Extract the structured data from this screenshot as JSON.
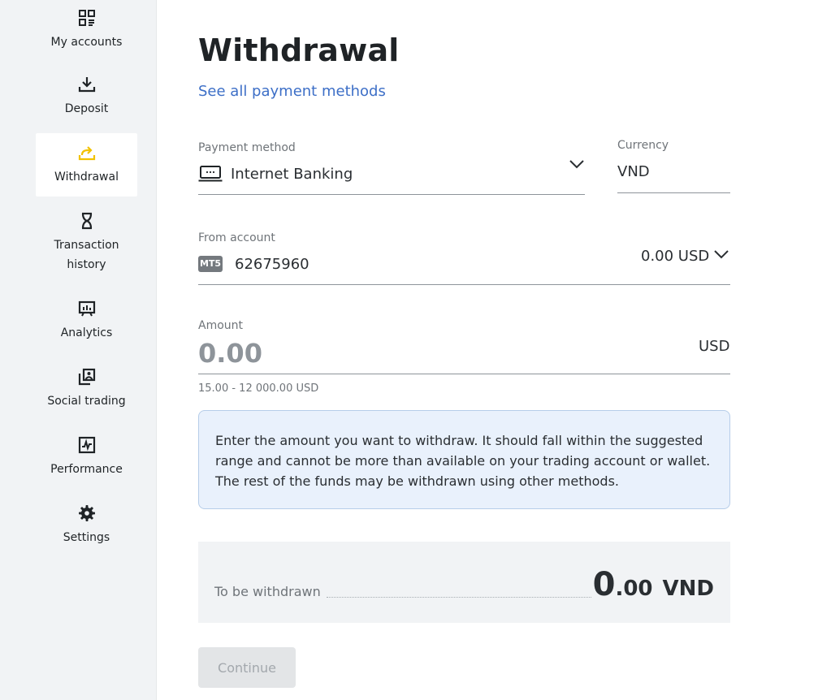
{
  "sidebar": {
    "items": [
      {
        "label": "My accounts",
        "icon": "accounts-grid-icon"
      },
      {
        "label": "Deposit",
        "icon": "download-icon"
      },
      {
        "label": "Withdrawal",
        "icon": "withdraw-upload-icon",
        "active": true
      },
      {
        "label": "Transaction\nhistory",
        "icon": "hourglass-icon"
      },
      {
        "label": "Analytics",
        "icon": "analytics-board-icon"
      },
      {
        "label": "Social trading",
        "icon": "social-trading-icon"
      },
      {
        "label": "Performance",
        "icon": "performance-chart-icon"
      },
      {
        "label": "Settings",
        "icon": "gear-icon"
      }
    ]
  },
  "page": {
    "title": "Withdrawal",
    "all_methods_link": "See all payment methods"
  },
  "payment_method": {
    "label": "Payment method",
    "value": "Internet Banking"
  },
  "currency": {
    "label": "Currency",
    "value": "VND"
  },
  "from_account": {
    "label": "From account",
    "platform_badge": "MT5",
    "account_number": "62675960",
    "balance": "0.00 USD"
  },
  "amount": {
    "label": "Amount",
    "placeholder": "0.00",
    "currency": "USD",
    "range_hint": "15.00 - 12 000.00 USD"
  },
  "info_message": "Enter the amount you want to withdraw. It should fall within the suggested range and cannot be more than available on your trading account or wallet. The rest of the funds may be withdrawn using other methods.",
  "summary": {
    "label": "To be withdrawn",
    "amount_integer": "0",
    "amount_decimal": ".00",
    "currency": "VND"
  },
  "continue_label": "Continue",
  "colors": {
    "accent_link": "#3d6fc7",
    "active_icon": "#f2c200",
    "info_bg": "#e9f1fc",
    "sidebar_bg": "#f1f3f5"
  }
}
